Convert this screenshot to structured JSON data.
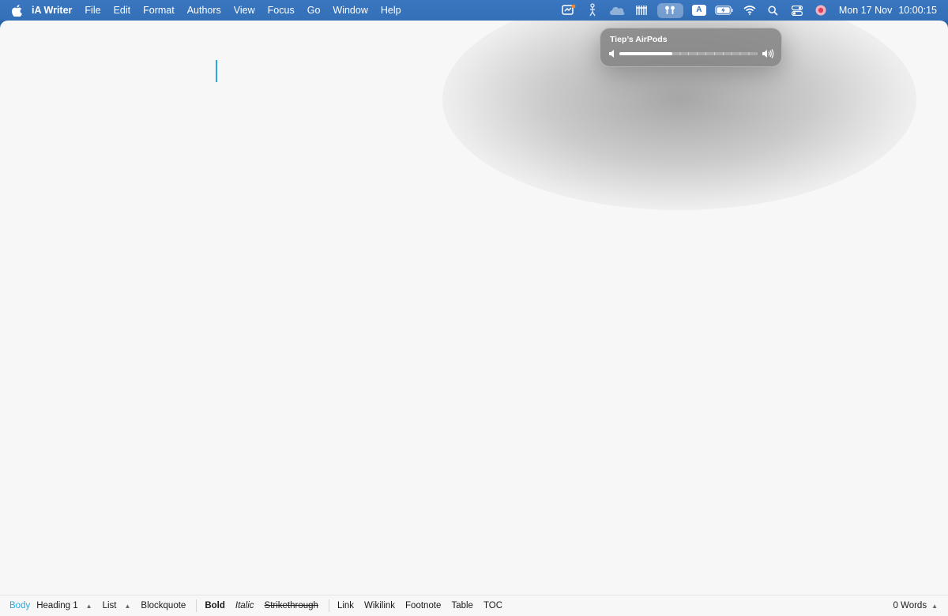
{
  "menubar": {
    "app_name": "iA Writer",
    "menus": [
      "File",
      "Edit",
      "Format",
      "Authors",
      "View",
      "Focus",
      "Go",
      "Window",
      "Help"
    ],
    "status_icons": [
      "screen-annotate-icon",
      "figure-icon",
      "cloud-icon",
      "utensils-icon",
      "airpods-icon",
      "input-source-icon",
      "battery-icon",
      "wifi-icon",
      "search-icon",
      "control-center-icon",
      "user-avatar-icon"
    ],
    "input_source_letter": "A",
    "date": "Mon 17 Nov",
    "time": "10:00:15"
  },
  "volume_popover": {
    "device_name": "Tiep’s AirPods",
    "volume_fraction": 0.38
  },
  "format_bar": {
    "items": {
      "body": "Body",
      "heading": "Heading 1",
      "list": "List",
      "blockquote": "Blockquote",
      "bold": "Bold",
      "italic": "Italic",
      "strikethrough": "Strikethrough",
      "link": "Link",
      "wikilink": "Wikilink",
      "footnote": "Footnote",
      "table": "Table",
      "toc": "TOC"
    },
    "word_count": "0 Words"
  },
  "colors": {
    "menubar": "#3470b8",
    "accent": "#27a9e1",
    "editor_background": "#f7f7f7"
  }
}
